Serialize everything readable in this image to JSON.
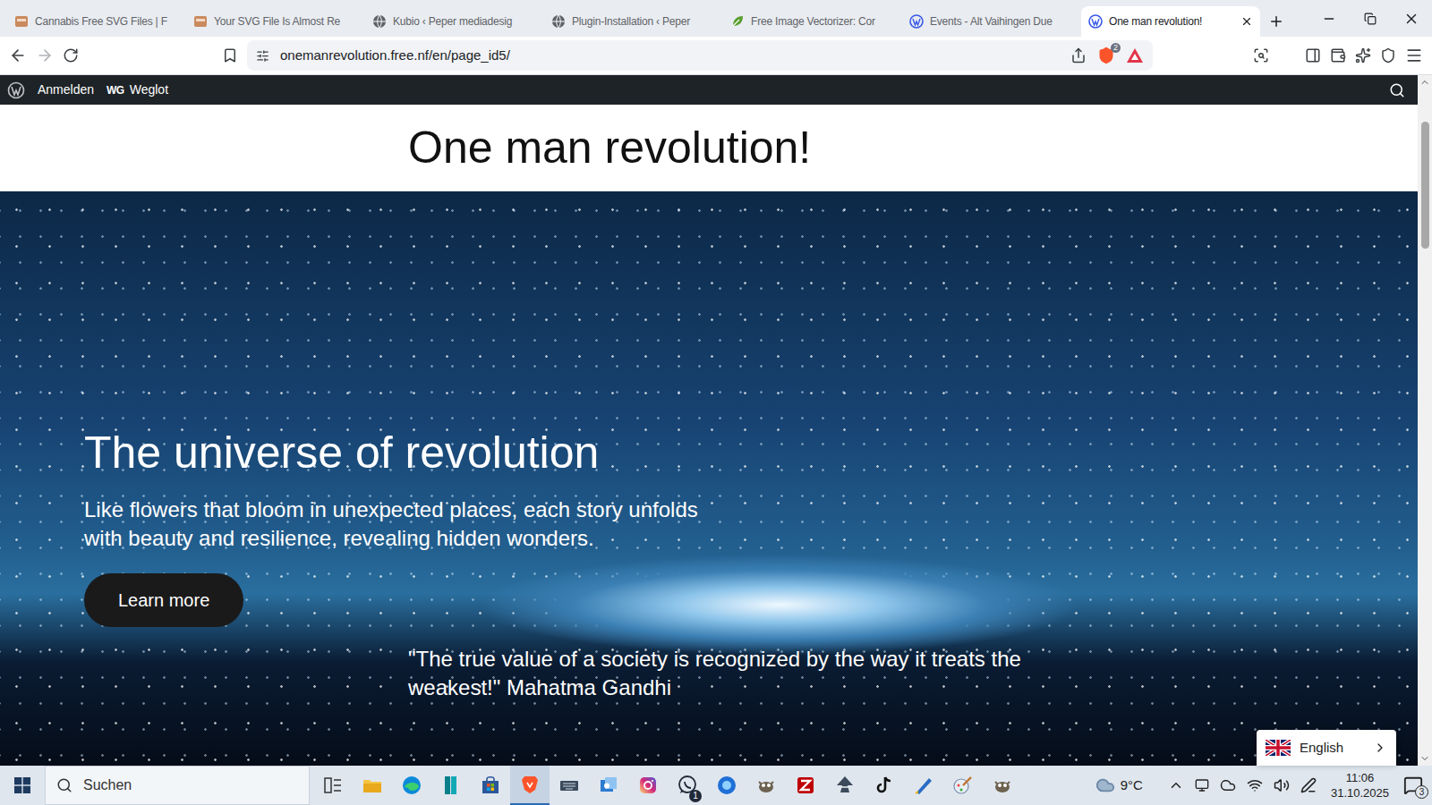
{
  "browser": {
    "tabs": [
      {
        "label": "Cannabis Free SVG Files | F",
        "kind": "photo",
        "selected": false
      },
      {
        "label": "Your SVG File Is Almost Re",
        "kind": "photo",
        "selected": false
      },
      {
        "label": "Kubio ‹ Peper mediadesig",
        "kind": "globe",
        "selected": false
      },
      {
        "label": "Plugin-Installation ‹ Peper",
        "kind": "globe",
        "selected": false
      },
      {
        "label": "Free Image Vectorizer: Cor",
        "kind": "leaf",
        "selected": false
      },
      {
        "label": "Events - Alt Vaihingen Due",
        "kind": "wordpress",
        "selected": false
      },
      {
        "label": "One man revolution!",
        "kind": "wordpress",
        "selected": true
      }
    ],
    "address": "onemanrevolution.free.nf/en/page_id5/",
    "shield_count": "2"
  },
  "admin_bar": {
    "login": "Anmelden",
    "plugin_logo": "WG",
    "plugin": "Weglot"
  },
  "page": {
    "site_title": "One man revolution!",
    "hero": {
      "heading": "The universe of revolution",
      "text": "Like flowers that bloom in unexpected places, each story unfolds with beauty and resilience, revealing hidden wonders.",
      "button": "Learn more",
      "quote": "\"The true value of a society is recognized by the way it treats the weakest!\" Mahatma Gandhi"
    }
  },
  "language_switcher": {
    "label": "English"
  },
  "taskbar": {
    "search_placeholder": "Suchen",
    "apps": [
      {
        "kind": "taskview",
        "active": false,
        "badge": ""
      },
      {
        "kind": "explorer",
        "active": false,
        "badge": ""
      },
      {
        "kind": "edge",
        "active": false,
        "badge": ""
      },
      {
        "kind": "teal",
        "active": false,
        "badge": ""
      },
      {
        "kind": "store",
        "active": false,
        "badge": ""
      },
      {
        "kind": "brave",
        "active": true,
        "badge": ""
      },
      {
        "kind": "keyboard",
        "active": false,
        "badge": ""
      },
      {
        "kind": "mail",
        "active": false,
        "badge": ""
      },
      {
        "kind": "instagram",
        "active": false,
        "badge": ""
      },
      {
        "kind": "whatsapp",
        "active": false,
        "badge": "1"
      },
      {
        "kind": "bluecircle",
        "active": false,
        "badge": ""
      },
      {
        "kind": "gimp",
        "active": false,
        "badge": ""
      },
      {
        "kind": "filezilla",
        "active": false,
        "badge": ""
      },
      {
        "kind": "inkscape",
        "active": false,
        "badge": ""
      },
      {
        "kind": "tiktok",
        "active": false,
        "badge": ""
      },
      {
        "kind": "pen",
        "active": false,
        "badge": ""
      },
      {
        "kind": "brush",
        "active": false,
        "badge": ""
      },
      {
        "kind": "gimp",
        "active": false,
        "badge": ""
      }
    ],
    "weather": "9°C",
    "time": "11:06",
    "date": "31.10.2025",
    "notifications": "3"
  }
}
